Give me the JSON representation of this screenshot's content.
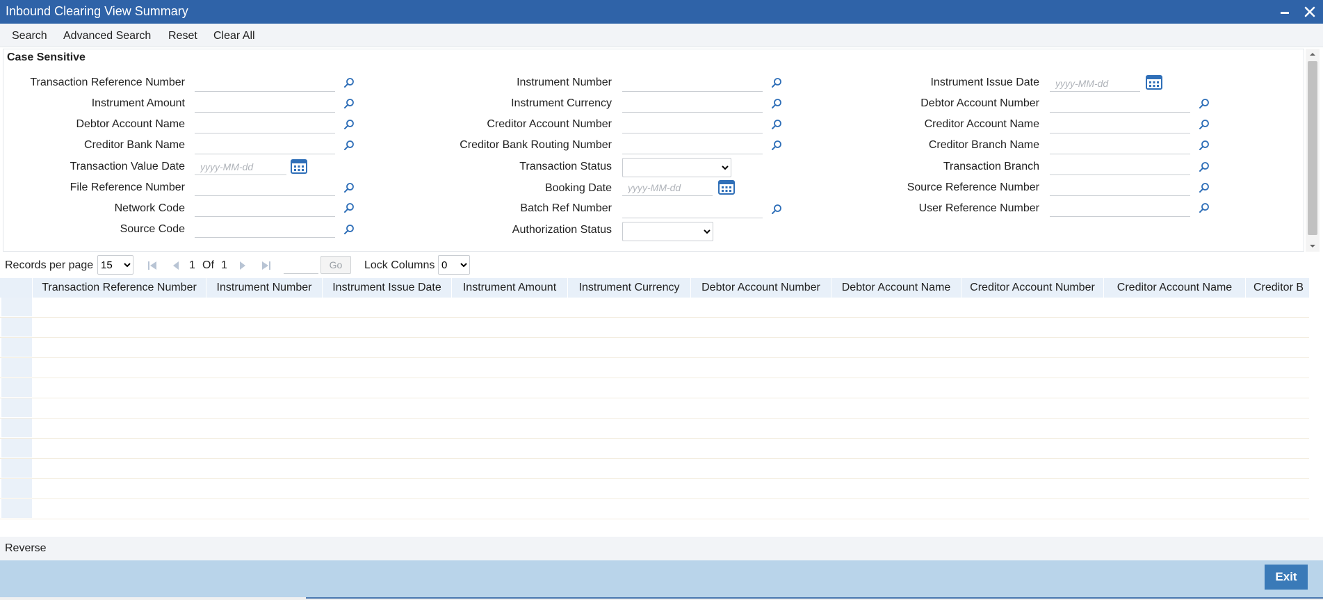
{
  "window": {
    "title": "Inbound Clearing View Summary",
    "icons": {
      "minimize": "minimize-icon",
      "close": "close-icon"
    }
  },
  "toolbar": {
    "search": "Search",
    "advanced_search": "Advanced Search",
    "reset": "Reset",
    "clear_all": "Clear All"
  },
  "panel": {
    "case_sensitive": "Case Sensitive"
  },
  "fields": {
    "txn_ref_number": "Transaction Reference Number",
    "instrument_amount": "Instrument Amount",
    "debtor_account_name": "Debtor Account Name",
    "creditor_bank_name": "Creditor Bank Name",
    "txn_value_date": "Transaction Value Date",
    "file_ref_number": "File Reference Number",
    "network_code": "Network Code",
    "source_code": "Source Code",
    "instrument_number": "Instrument Number",
    "instrument_currency": "Instrument Currency",
    "creditor_account_number": "Creditor Account Number",
    "creditor_bank_routing_number": "Creditor Bank Routing Number",
    "transaction_status": "Transaction Status",
    "booking_date": "Booking Date",
    "batch_ref_number": "Batch Ref Number",
    "authorization_status": "Authorization Status",
    "instrument_issue_date": "Instrument Issue Date",
    "debtor_account_number": "Debtor Account Number",
    "creditor_account_name": "Creditor Account Name",
    "creditor_branch_name": "Creditor Branch Name",
    "transaction_branch": "Transaction Branch",
    "source_ref_number": "Source Reference Number",
    "user_ref_number": "User Reference Number",
    "date_placeholder": "yyyy-MM-dd"
  },
  "pager": {
    "records_per_page_label": "Records per page",
    "records_per_page_value": "15",
    "current_page": "1",
    "of_label": "Of",
    "total_pages": "1",
    "go_label": "Go",
    "lock_columns_label": "Lock Columns",
    "lock_columns_value": "0"
  },
  "grid": {
    "columns": [
      "Transaction Reference Number",
      "Instrument Number",
      "Instrument Issue Date",
      "Instrument Amount",
      "Instrument Currency",
      "Debtor Account Number",
      "Debtor Account Name",
      "Creditor Account Number",
      "Creditor Account Name",
      "Creditor B"
    ],
    "row_count": 11
  },
  "bottom": {
    "reverse": "Reverse",
    "exit": "Exit"
  },
  "colors": {
    "titlebar": "#2f63a8",
    "toolbar": "#f2f4f7",
    "grid_header": "#e8f0f9",
    "footer": "#b9d4ea",
    "exit_button": "#3a7ab8",
    "icon_blue": "#2f6fb8"
  }
}
